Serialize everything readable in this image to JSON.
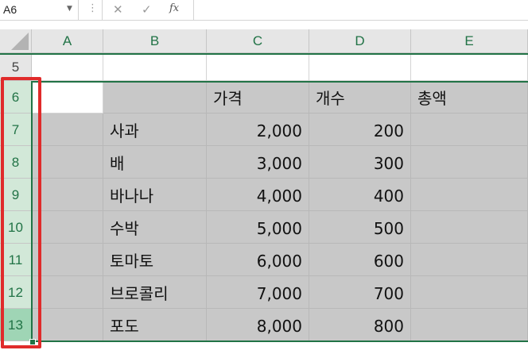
{
  "formula_bar": {
    "name_box": "A6",
    "formula": ""
  },
  "columns": [
    "A",
    "B",
    "C",
    "D",
    "E"
  ],
  "rows": [
    {
      "num": "5",
      "cells": [
        "",
        "",
        "",
        "",
        ""
      ]
    },
    {
      "num": "6",
      "cells": [
        "",
        "",
        "가격",
        "개수",
        "총액"
      ]
    },
    {
      "num": "7",
      "cells": [
        "",
        "사과",
        "2,000",
        "200",
        ""
      ]
    },
    {
      "num": "8",
      "cells": [
        "",
        "배",
        "3,000",
        "300",
        ""
      ]
    },
    {
      "num": "9",
      "cells": [
        "",
        "바나나",
        "4,000",
        "400",
        ""
      ]
    },
    {
      "num": "10",
      "cells": [
        "",
        "수박",
        "5,000",
        "500",
        ""
      ]
    },
    {
      "num": "11",
      "cells": [
        "",
        "토마토",
        "6,000",
        "600",
        ""
      ]
    },
    {
      "num": "12",
      "cells": [
        "",
        "브로콜리",
        "7,000",
        "700",
        ""
      ]
    },
    {
      "num": "13",
      "cells": [
        "",
        "포도",
        "8,000",
        "800",
        ""
      ]
    }
  ],
  "colors": {
    "accent": "#217346",
    "highlight": "#e02b2b",
    "shade": "#c8c8c8"
  }
}
